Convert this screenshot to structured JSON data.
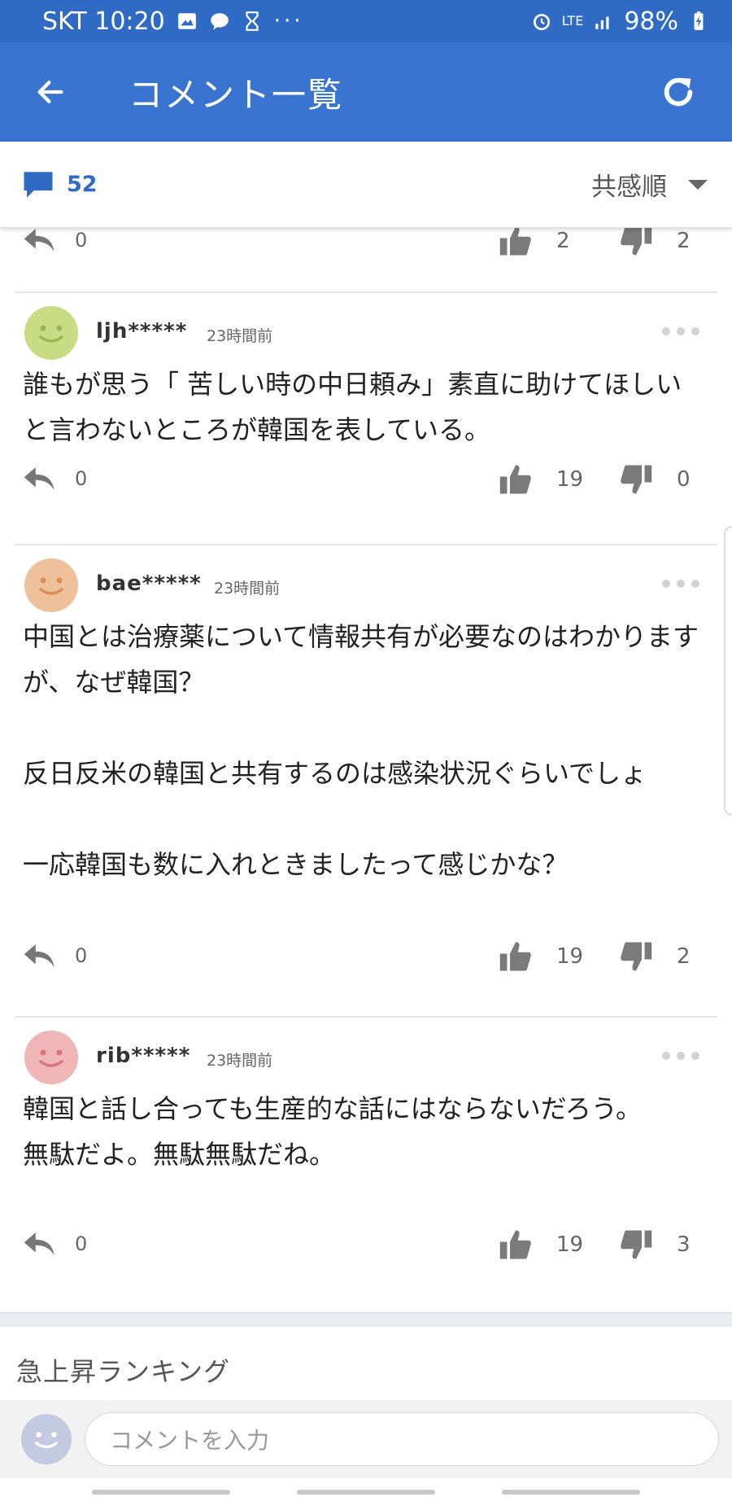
{
  "status_bar": {
    "carrier_time": "SKT 10:20",
    "network": "LTE",
    "battery": "98%"
  },
  "app_bar": {
    "title": "コメント一覧"
  },
  "sort_bar": {
    "comment_count": "52",
    "sort_label": "共感順"
  },
  "top_partial": {
    "replies": "0",
    "likes": "2",
    "dislikes": "2"
  },
  "comments": [
    {
      "user": "ljh*****",
      "time": "23時間前",
      "avatar_color": "#c9dc84",
      "text": "誰もが思う「 苦しい時の中日頼み」素直に助けてほしいと言わないところが韓国を表している。",
      "replies": "0",
      "likes": "19",
      "dislikes": "0"
    },
    {
      "user": "bae*****",
      "time": "23時間前",
      "avatar_color": "#efc19a",
      "text": "中国とは治療薬について情報共有が必要なのはわかりますが、なぜ韓国？\n\n反日反米の韓国と共有するのは感染状況ぐらいでしょ\n\n一応韓国も数に入れときましたって感じかな？",
      "replies": "0",
      "likes": "19",
      "dislikes": "2"
    },
    {
      "user": "rib*****",
      "time": "23時間前",
      "avatar_color": "#f0b5b7",
      "text": "韓国と話し合っても生産的な話にはならないだろう。\n無駄だよ。無駄無駄だね。",
      "replies": "0",
      "likes": "19",
      "dislikes": "3"
    }
  ],
  "ranking_title": "急上昇ランキング",
  "comment_input": {
    "placeholder": "コメントを入力"
  }
}
